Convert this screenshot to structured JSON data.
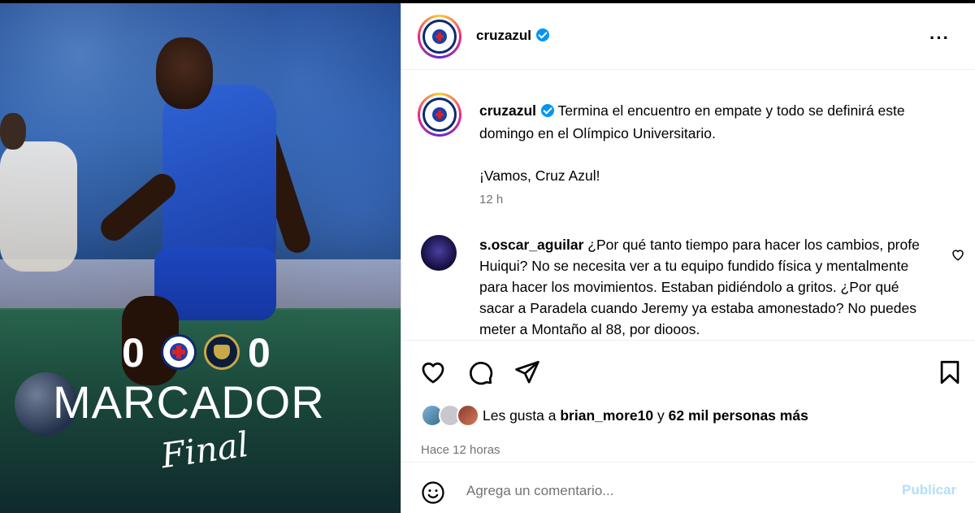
{
  "media": {
    "score_home": "0",
    "score_away": "0",
    "headline": "MARCADOR",
    "subline": "Final"
  },
  "post_header": {
    "username": "cruzazul",
    "more_icon": "more-horizontal-icon",
    "more_label": "···"
  },
  "caption": {
    "username": "cruzazul",
    "text": "Termina el encuentro en empate y todo se definirá este domingo en el Olímpico Universitario.",
    "text_line2": "¡Vamos, Cruz Azul!",
    "time": "12 h"
  },
  "comment": {
    "username": "s.oscar_aguilar",
    "text": "¿Por qué tanto tiempo para hacer los cambios, profe Huiqui? No se necesita ver a tu equipo fundido física y mentalmente para hacer los movimientos. Estaban pidiéndolo a gritos. ¿Por qué sacar a Paradela cuando Jeremy ya estaba amonestado? No puedes meter a Montaño al 88, por diooos."
  },
  "actions": {
    "likes_prefix": "Les gusta a ",
    "likes_user": "brian_more10",
    "likes_mid": " y ",
    "likes_count": "62 mil personas más",
    "post_time": "Hace 12 horas"
  },
  "comment_box": {
    "placeholder": "Agrega un comentario...",
    "publish_label": "Publicar"
  },
  "colors": {
    "verified": "#0095f6",
    "publish_disabled": "#b2dffc",
    "secondary_text": "#737373"
  }
}
